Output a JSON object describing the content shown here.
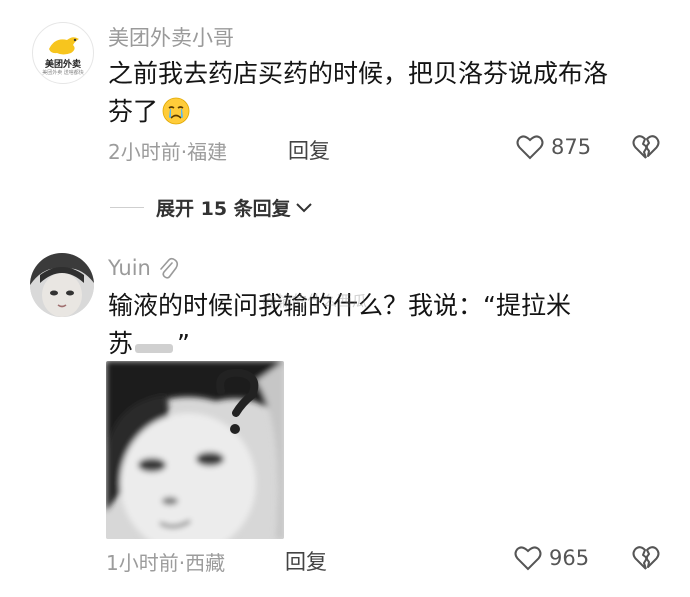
{
  "comments": [
    {
      "username": "美团外卖小哥",
      "avatar_logo_text": "美团外卖",
      "avatar_logo_subtext": "美团外卖 送啥都快",
      "content_line1": "之前我去药店买药的时候，把贝洛芬说成布洛",
      "content_line2": "芬了",
      "emoji_icon": "crying-face-icon",
      "time_location": "2小时前·福建",
      "reply_label": "回复",
      "like_count": "875"
    },
    {
      "username": "Yuin",
      "content_line1": "输液的时候问我输的什么？我说：“提拉米",
      "content_line2": "苏",
      "content_line2_end": "”",
      "watermark": "@输的什么西瓜",
      "time_location": "1小时前·西藏",
      "reply_label": "回复",
      "like_count": "965"
    }
  ],
  "expand": {
    "label": "展开 15 条回复"
  },
  "colors": {
    "logo_bg": "#f7c51e",
    "text": "#141414",
    "muted": "#9c9c9c"
  }
}
